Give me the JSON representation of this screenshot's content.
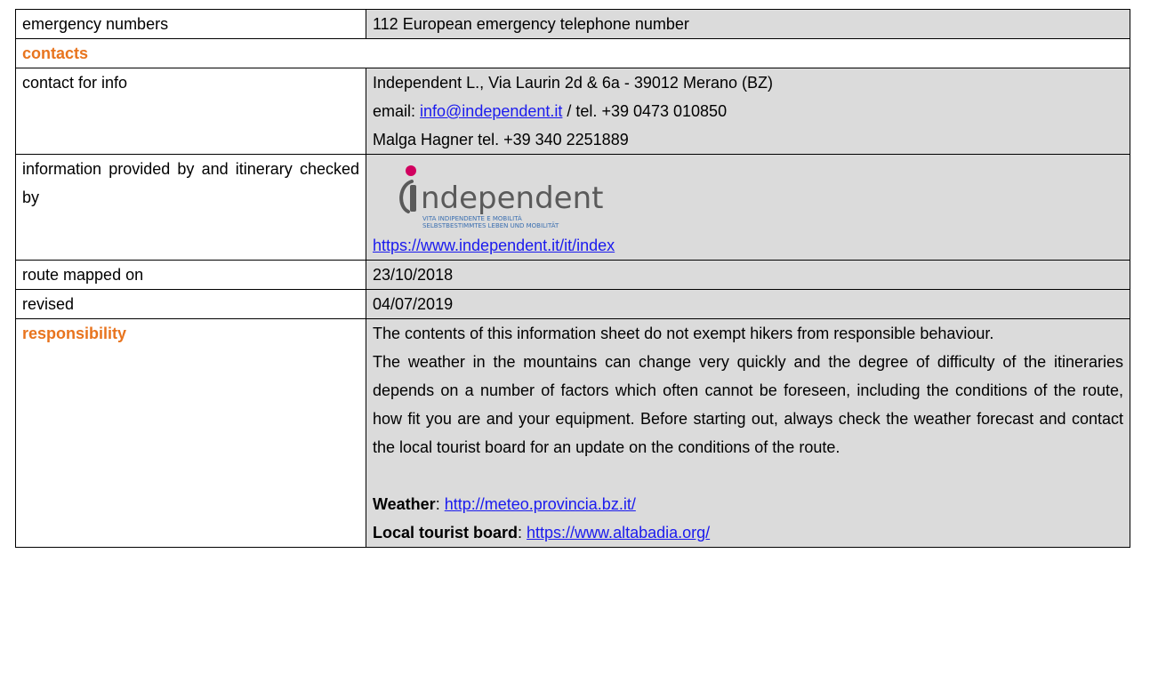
{
  "rows": {
    "emergency": {
      "label": "emergency numbers",
      "value": "112 European emergency telephone number"
    },
    "contacts_header": "contacts",
    "contact_info": {
      "label": "contact for info",
      "line1": "Independent L., Via Laurin 2d & 6a - 39012 Merano (BZ)",
      "email_prefix": "email: ",
      "email": "info@independent.it",
      "tel": " / tel. +39 0473 010850",
      "line3": "Malga Hagner tel. +39 340 2251889"
    },
    "provided_by": {
      "label": "information provided by and itinerary checked by",
      "logo_name": "ndependent",
      "logo_sub1": "VITA INDIPENDENTE E MOBILITÀ",
      "logo_sub2": "SELBSTBESTIMMTES LEBEN UND MOBILITÄT",
      "logo_color": "#d1005f",
      "link": "https://www.independent.it/it/index"
    },
    "mapped": {
      "label": "route mapped on",
      "value": "23/10/2018"
    },
    "revised": {
      "label": "revised",
      "value": "04/07/2019"
    },
    "responsibility": {
      "label": "responsibility",
      "para1": "The contents of this information sheet do not exempt hikers from responsible behaviour.",
      "para2": "The weather in the mountains can change very quickly and the degree of difficulty of the itineraries depends on a number of factors which often cannot be foreseen, including the conditions of the route, how fit you are and your equipment. Before starting out, always check the weather forecast and contact the local tourist board for an update on the conditions of the route.",
      "weather_label": "Weather",
      "weather_sep": ": ",
      "weather_link": "http://meteo.provincia.bz.it/",
      "tourist_label": "Local tourist board",
      "tourist_sep": ": ",
      "tourist_link": "https://www.altabadia.org/"
    }
  },
  "colors": {
    "accent": "#e8741e",
    "value_bg": "#dbdbdb",
    "link": "#1a1aee"
  }
}
